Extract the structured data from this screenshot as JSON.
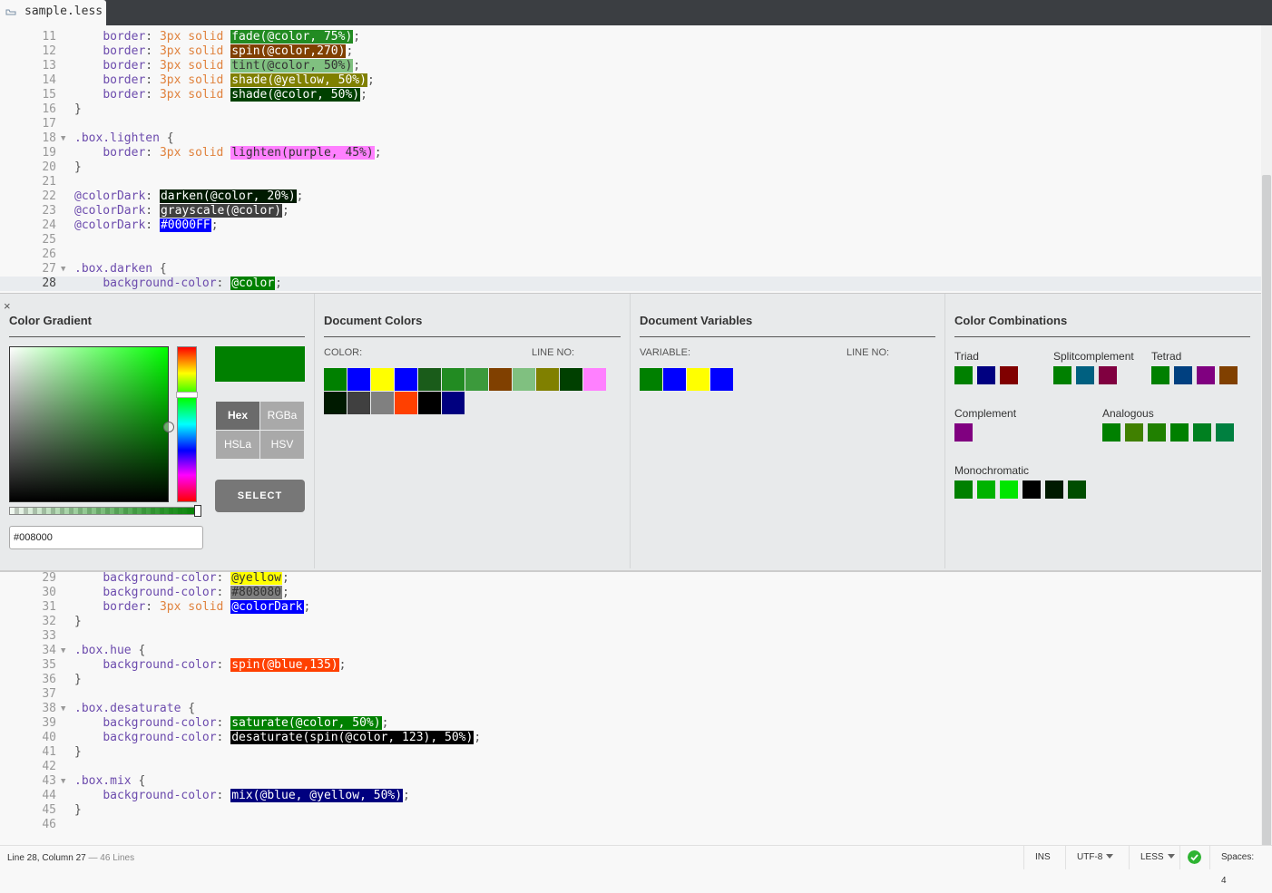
{
  "tab": {
    "filename": "sample.less"
  },
  "code_top": [
    {
      "n": "11",
      "segs": [
        [
          "    ",
          ""
        ],
        [
          "border",
          ":p"
        ],
        [
          ": ",
          ""
        ],
        [
          "3px",
          "num"
        ],
        [
          " ",
          ""
        ],
        [
          "solid",
          "kw"
        ],
        [
          " ",
          ""
        ],
        [
          "fade(@color, 75%)",
          "sw:#228b22:#fff"
        ],
        [
          ";",
          ""
        ]
      ]
    },
    {
      "n": "12",
      "segs": [
        [
          "    ",
          ""
        ],
        [
          "border",
          ":p"
        ],
        [
          ": ",
          ""
        ],
        [
          "3px",
          "num"
        ],
        [
          " ",
          ""
        ],
        [
          "solid",
          "kw"
        ],
        [
          " ",
          ""
        ],
        [
          "spin(@color,270)",
          "sw:#804000:#fff"
        ],
        [
          ";",
          ""
        ]
      ]
    },
    {
      "n": "13",
      "segs": [
        [
          "    ",
          ""
        ],
        [
          "border",
          ":p"
        ],
        [
          ": ",
          ""
        ],
        [
          "3px",
          "num"
        ],
        [
          " ",
          ""
        ],
        [
          "solid",
          "kw"
        ],
        [
          " ",
          ""
        ],
        [
          "tint(@color, 50%)",
          "sw:#80c080:#333"
        ],
        [
          ";",
          ""
        ]
      ]
    },
    {
      "n": "14",
      "segs": [
        [
          "    ",
          ""
        ],
        [
          "border",
          ":p"
        ],
        [
          ": ",
          ""
        ],
        [
          "3px",
          "num"
        ],
        [
          " ",
          ""
        ],
        [
          "solid",
          "kw"
        ],
        [
          " ",
          ""
        ],
        [
          "shade(@yellow, 50%)",
          "sw:#808000:#fff"
        ],
        [
          ";",
          ""
        ]
      ]
    },
    {
      "n": "15",
      "segs": [
        [
          "    ",
          ""
        ],
        [
          "border",
          ":p"
        ],
        [
          ": ",
          ""
        ],
        [
          "3px",
          "num"
        ],
        [
          " ",
          ""
        ],
        [
          "solid",
          "kw"
        ],
        [
          " ",
          ""
        ],
        [
          "shade(@color, 50%)",
          "sw:#004000:#fff"
        ],
        [
          ";",
          ""
        ]
      ]
    },
    {
      "n": "16",
      "segs": [
        [
          "}",
          ""
        ]
      ]
    },
    {
      "n": "17",
      "segs": []
    },
    {
      "n": "18",
      "fold": true,
      "segs": [
        [
          ".box.lighten",
          "sel"
        ],
        [
          " {",
          ""
        ]
      ]
    },
    {
      "n": "19",
      "segs": [
        [
          "    ",
          ""
        ],
        [
          "border",
          ":p"
        ],
        [
          ": ",
          ""
        ],
        [
          "3px",
          "num"
        ],
        [
          " ",
          ""
        ],
        [
          "solid",
          "kw"
        ],
        [
          " ",
          ""
        ],
        [
          "lighten(purple, 45%)",
          "sw:#ff80ff:#333"
        ],
        [
          ";",
          ""
        ]
      ]
    },
    {
      "n": "20",
      "segs": [
        [
          "}",
          ""
        ]
      ]
    },
    {
      "n": "21",
      "segs": []
    },
    {
      "n": "22",
      "segs": [
        [
          "@colorDark",
          "var"
        ],
        [
          ": ",
          ""
        ],
        [
          "darken(@color, 20%)",
          "sw:#001a00:#fff"
        ],
        [
          ";",
          ""
        ]
      ]
    },
    {
      "n": "23",
      "segs": [
        [
          "@colorDark",
          "var"
        ],
        [
          ": ",
          ""
        ],
        [
          "grayscale(@color)",
          "sw:#404040:#fff"
        ],
        [
          ";",
          ""
        ]
      ]
    },
    {
      "n": "24",
      "segs": [
        [
          "@colorDark",
          "var"
        ],
        [
          ": ",
          ""
        ],
        [
          "#0000FF",
          "sw:#0000ff:#fff"
        ],
        [
          ";",
          ""
        ]
      ]
    },
    {
      "n": "25",
      "segs": []
    },
    {
      "n": "26",
      "segs": []
    },
    {
      "n": "27",
      "fold": true,
      "segs": [
        [
          ".box.darken",
          "sel"
        ],
        [
          " {",
          ""
        ]
      ]
    },
    {
      "n": "28",
      "active": true,
      "segs": [
        [
          "    ",
          ""
        ],
        [
          "background-color",
          ":p"
        ],
        [
          ": ",
          ""
        ],
        [
          "@color",
          "sw:#008000:#fff"
        ],
        [
          ";",
          ""
        ]
      ]
    }
  ],
  "code_bottom": [
    {
      "n": "29",
      "segs": [
        [
          "    ",
          ""
        ],
        [
          "background-color",
          ":p"
        ],
        [
          ": ",
          ""
        ],
        [
          "@yellow",
          "sw:#ffff00:#333"
        ],
        [
          ";",
          ""
        ]
      ]
    },
    {
      "n": "30",
      "segs": [
        [
          "    ",
          ""
        ],
        [
          "background-color",
          ":p"
        ],
        [
          ": ",
          ""
        ],
        [
          "#808080",
          "sw:#808080:#333"
        ],
        [
          ";",
          ""
        ]
      ]
    },
    {
      "n": "31",
      "segs": [
        [
          "    ",
          ""
        ],
        [
          "border",
          ":p"
        ],
        [
          ": ",
          ""
        ],
        [
          "3px",
          "num"
        ],
        [
          " ",
          ""
        ],
        [
          "solid",
          "kw"
        ],
        [
          " ",
          ""
        ],
        [
          "@colorDark",
          "sw:#0000ff:#fff"
        ],
        [
          ";",
          ""
        ]
      ]
    },
    {
      "n": "32",
      "segs": [
        [
          "}",
          ""
        ]
      ]
    },
    {
      "n": "33",
      "segs": []
    },
    {
      "n": "34",
      "fold": true,
      "segs": [
        [
          ".box.hue",
          "sel"
        ],
        [
          " {",
          ""
        ]
      ]
    },
    {
      "n": "35",
      "segs": [
        [
          "    ",
          ""
        ],
        [
          "background-color",
          ":p"
        ],
        [
          ": ",
          ""
        ],
        [
          "spin(@blue,135)",
          "sw:#ff4000:#fff"
        ],
        [
          ";",
          ""
        ]
      ]
    },
    {
      "n": "36",
      "segs": [
        [
          "}",
          ""
        ]
      ]
    },
    {
      "n": "37",
      "segs": []
    },
    {
      "n": "38",
      "fold": true,
      "segs": [
        [
          ".box.desaturate",
          "sel"
        ],
        [
          " {",
          ""
        ]
      ]
    },
    {
      "n": "39",
      "segs": [
        [
          "    ",
          ""
        ],
        [
          "background-color",
          ":p"
        ],
        [
          ": ",
          ""
        ],
        [
          "saturate(@color, 50%)",
          "sw:#008000:#fff"
        ],
        [
          ";",
          ""
        ]
      ]
    },
    {
      "n": "40",
      "segs": [
        [
          "    ",
          ""
        ],
        [
          "background-color",
          ":p"
        ],
        [
          ": ",
          ""
        ],
        [
          "desaturate(spin(@color, 123), 50%)",
          "sw:#000000:#fff"
        ],
        [
          ";",
          ""
        ]
      ]
    },
    {
      "n": "41",
      "segs": [
        [
          "}",
          ""
        ]
      ]
    },
    {
      "n": "42",
      "segs": []
    },
    {
      "n": "43",
      "fold": true,
      "segs": [
        [
          ".box.mix",
          "sel"
        ],
        [
          " {",
          ""
        ]
      ]
    },
    {
      "n": "44",
      "segs": [
        [
          "    ",
          ""
        ],
        [
          "background-color",
          ":p"
        ],
        [
          ": ",
          ""
        ],
        [
          "mix(@blue, @yellow, 50%)",
          "sw:#00007f:#fff"
        ],
        [
          ";",
          ""
        ]
      ]
    },
    {
      "n": "45",
      "segs": [
        [
          "}",
          ""
        ]
      ]
    },
    {
      "n": "46",
      "segs": []
    }
  ],
  "panel": {
    "close": "×",
    "gradient": {
      "title": "Color Gradient",
      "hex_value": "#008000",
      "preview_color": "#008000",
      "formats": [
        "Hex",
        "RGBa",
        "HSLa",
        "HSV"
      ],
      "active_format": "Hex",
      "select_label": "SELECT"
    },
    "doc_colors": {
      "title": "Document Colors",
      "col1": "COLOR:",
      "col2": "LINE NO:",
      "swatches": [
        "#008000",
        "#0000ff",
        "#ffff00",
        "#0000ff",
        "#1a5c1a",
        "#228b22",
        "#3c9a3c",
        "#804000",
        "#80c080",
        "#808000",
        "#004000",
        "#ff80ff",
        "#001a00",
        "#404040",
        "#808080",
        "#ff4000",
        "#000000",
        "#00007f"
      ]
    },
    "doc_vars": {
      "title": "Document Variables",
      "col1": "VARIABLE:",
      "col2": "LINE NO:",
      "swatches": [
        "#008000",
        "#0000ff",
        "#ffff00",
        "#0000ff"
      ]
    },
    "combos": {
      "title": "Color Combinations",
      "triad": {
        "label": "Triad",
        "colors": [
          "#008000",
          "#000080",
          "#800000"
        ]
      },
      "split": {
        "label": "Splitcomplement",
        "colors": [
          "#008000",
          "#006080",
          "#800040"
        ]
      },
      "tetrad": {
        "label": "Tetrad",
        "colors": [
          "#008000",
          "#004080",
          "#800080",
          "#804000"
        ]
      },
      "complement": {
        "label": "Complement",
        "colors": [
          "#800080"
        ]
      },
      "analogous": {
        "label": "Analogous",
        "colors": [
          "#008000",
          "#408000",
          "#208000",
          "#008000",
          "#008020",
          "#008040"
        ]
      },
      "mono": {
        "label": "Monochromatic",
        "colors": [
          "#008000",
          "#00b300",
          "#00e600",
          "#000000",
          "#001a00",
          "#004d00"
        ]
      }
    }
  },
  "status": {
    "position": "Line 28, Column 27",
    "lines": "— 46 Lines",
    "mode": "INS",
    "encoding": "UTF-8",
    "language": "LESS",
    "spaces": "Spaces:  4"
  }
}
